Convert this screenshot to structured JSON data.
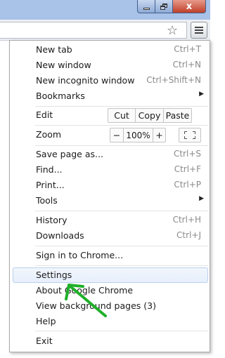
{
  "colors": {
    "title_bar": "#a8c2e8",
    "close_button": "#c0402a",
    "menu_hover": "#e6effb",
    "annotation_arrow": "#1fb02a"
  },
  "window": {
    "close_label": "x"
  },
  "toolbar": {
    "star_icon": "star-icon",
    "menu_icon": "hamburger-menu-icon"
  },
  "menu": {
    "new_tab": {
      "label": "New tab",
      "shortcut": "Ctrl+T"
    },
    "new_window": {
      "label": "New window",
      "shortcut": "Ctrl+N"
    },
    "new_incognito": {
      "label": "New incognito window",
      "shortcut": "Ctrl+Shift+N"
    },
    "bookmarks": {
      "label": "Bookmarks"
    },
    "edit": {
      "label": "Edit",
      "cut": "Cut",
      "copy": "Copy",
      "paste": "Paste"
    },
    "zoom": {
      "label": "Zoom",
      "minus": "−",
      "level": "100%",
      "plus": "+"
    },
    "save_page": {
      "label": "Save page as...",
      "shortcut": "Ctrl+S"
    },
    "find": {
      "label": "Find...",
      "shortcut": "Ctrl+F"
    },
    "print": {
      "label": "Print...",
      "shortcut": "Ctrl+P"
    },
    "tools": {
      "label": "Tools"
    },
    "history": {
      "label": "History",
      "shortcut": "Ctrl+H"
    },
    "downloads": {
      "label": "Downloads",
      "shortcut": "Ctrl+J"
    },
    "sign_in": {
      "label": "Sign in to Chrome..."
    },
    "settings": {
      "label": "Settings"
    },
    "about": {
      "label": "About Google Chrome"
    },
    "background_pages": {
      "label": "View background pages (3)"
    },
    "help": {
      "label": "Help"
    },
    "exit": {
      "label": "Exit"
    }
  }
}
